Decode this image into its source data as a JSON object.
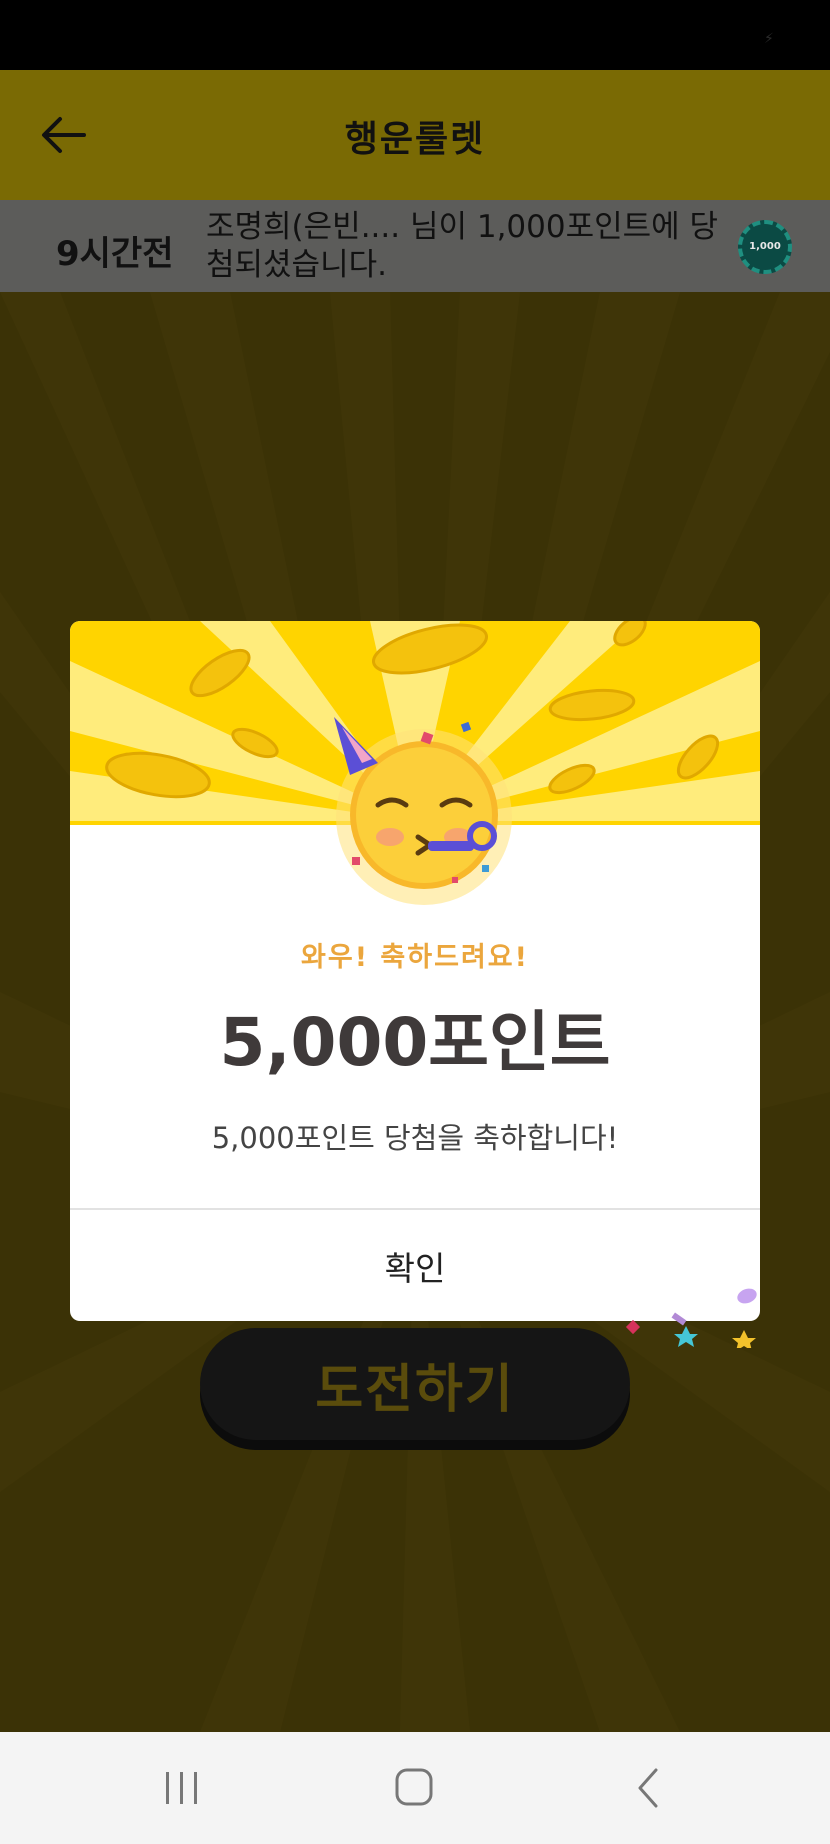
{
  "app": {
    "title": "행운룰렛",
    "back_icon": "arrow-left-icon"
  },
  "ticker": {
    "time": "9시간전",
    "message": "조명희(은빈.... 님이 1,000포인트에 당첨되셨습니다.",
    "chip_value": "1,000",
    "chip_icon": "poker-chip-icon"
  },
  "challenge": {
    "label": "도전하기"
  },
  "modal": {
    "emoji": "partying-face-icon",
    "subtitle": "와우! 축하드려요!",
    "points": "5,000포인트",
    "description": "5,000포인트 당첨을 축하합니다!",
    "confirm_label": "확인"
  },
  "navigation": {
    "recent_icon": "recent-apps-icon",
    "home_icon": "home-icon",
    "back_icon": "back-chevron-icon"
  },
  "colors": {
    "banner": "#ffd400",
    "subtitle": "#eba63d",
    "points_text": "#3f3a3a"
  }
}
